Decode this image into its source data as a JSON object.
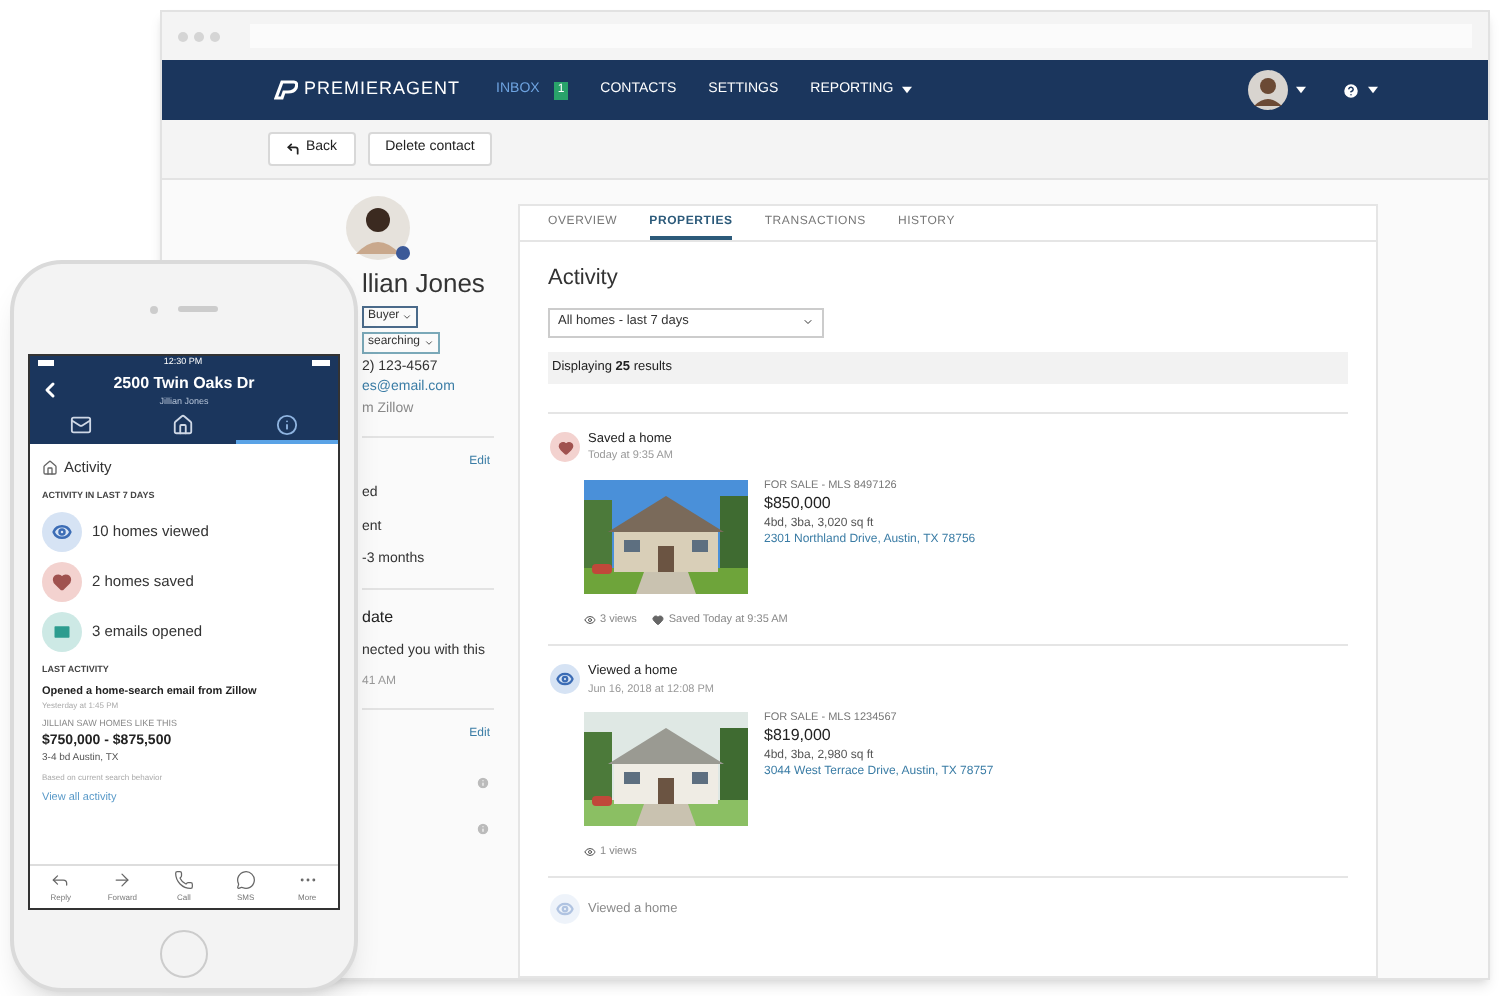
{
  "browser": {
    "nav": {
      "logo": "**PREMIER**AGENT",
      "items": [
        {
          "label": "INBOX",
          "selected": true,
          "badge": "1",
          "dropdown": false
        },
        {
          "label": "CONTACTS",
          "selected": false,
          "dropdown": false
        },
        {
          "label": "SETTINGS",
          "selected": false,
          "dropdown": false
        },
        {
          "label": "REPORTING",
          "selected": false,
          "dropdown": true
        }
      ]
    },
    "toolbar": [
      {
        "kind": "back",
        "label": "Back"
      },
      {
        "kind": "plain",
        "label": "Delete contact"
      }
    ],
    "contact": {
      "name": "llian Jones",
      "type": "Buyer",
      "status": "searching",
      "phone": "2) 123-4567",
      "email": "es@email.com",
      "source": "m Zillow",
      "sections": [
        {
          "kind": "details",
          "edit": "Edit",
          "lines": [
            {
              "text": "ed",
              "muted": false
            },
            {
              "text": "ent",
              "muted": false
            },
            {
              "text": "-3 months",
              "muted": false
            }
          ]
        },
        {
          "kind": "update",
          "heading": "date",
          "lines": [
            {
              "text": "nected you with this",
              "muted": false
            },
            {
              "text": "41 AM",
              "muted": true
            }
          ]
        },
        {
          "kind": "info",
          "edit": "Edit"
        }
      ]
    },
    "tabs": [
      {
        "label": "OVERVIEW",
        "selected": false
      },
      {
        "label": "PROPERTIES",
        "selected": true
      },
      {
        "label": "TRANSACTIONS",
        "selected": false
      },
      {
        "label": "HISTORY",
        "selected": false
      }
    ],
    "activity": {
      "heading": "Activity",
      "filter": "All homes - last 7 days",
      "results": "Displaying **25** results",
      "items": [
        {
          "kind": "saved",
          "title": "Saved a home",
          "time": "Today at 9:35 AM",
          "faded": false,
          "listing": {
            "status": "FOR SALE - MLS 8497126",
            "price": "$850,000",
            "specs": "4bd, 3ba, 3,020 sq ft",
            "address": "2301 Northland Drive, Austin, TX 78756"
          },
          "views": "3 views",
          "saved": "Saved Today at 9:35 AM"
        },
        {
          "kind": "viewed",
          "title": "Viewed a home",
          "time": "Jun 16, 2018 at 12:08 PM",
          "faded": false,
          "listing": {
            "status": "FOR SALE - MLS 1234567",
            "price": "$819,000",
            "specs": "4bd, 3ba, 2,980 sq ft",
            "address": "3044 West Terrace Drive, Austin, TX 78757"
          },
          "views": "1 views"
        },
        {
          "kind": "viewed",
          "title": "Viewed a home",
          "faded": true
        }
      ]
    }
  },
  "phone": {
    "time": "12:30 PM",
    "title": "2500 Twin Oaks Dr",
    "subtitle": "Jillian Jones",
    "tabs": [
      {
        "kind": "mail",
        "selected": false
      },
      {
        "kind": "home",
        "selected": false
      },
      {
        "kind": "info",
        "selected": true
      }
    ],
    "section": "Activity",
    "stats_label": "ACTIVITY IN LAST 7 DAYS",
    "stats": [
      {
        "kind": "viewed",
        "text": "10 homes viewed",
        "color": "#d6e3f4"
      },
      {
        "kind": "saved",
        "text": "2 homes saved",
        "color": "#f3d2cf"
      },
      {
        "kind": "emails",
        "text": "3 emails opened",
        "color": "#cde9e5"
      }
    ],
    "last_label": "LAST ACTIVITY",
    "last_text": "Opened a home-search email from Zillow",
    "last_time": "Yesterday at 1:45 PM",
    "similar_label": "JILLIAN SAW HOMES LIKE THIS",
    "similar_price": "$750,000 - $875,500",
    "similar_specs": "3-4 bd Austin, TX",
    "similar_note": "Based on current search behavior",
    "link": "View all activity",
    "actions": [
      {
        "kind": "reply",
        "label": "Reply"
      },
      {
        "kind": "forward",
        "label": "Forward"
      },
      {
        "kind": "call",
        "label": "Call"
      },
      {
        "kind": "sms",
        "label": "SMS"
      },
      {
        "kind": "more",
        "label": "More"
      }
    ]
  }
}
